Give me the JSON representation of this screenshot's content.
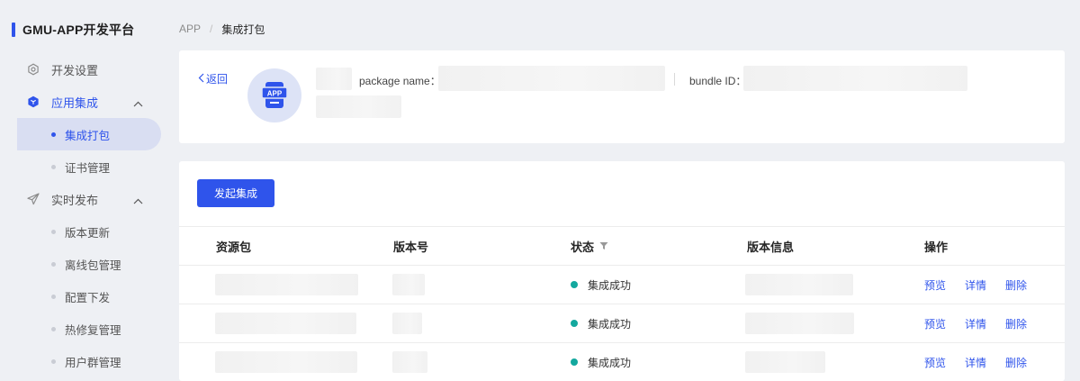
{
  "app": {
    "title": "GMU-APP开发平台"
  },
  "sidebar": {
    "groups": [
      {
        "label": "开发设置",
        "icon": "gear-icon"
      },
      {
        "label": "应用集成",
        "icon": "cube-icon",
        "expanded": true
      },
      {
        "label": "实时发布",
        "icon": "send-icon",
        "expanded": true
      }
    ],
    "sub_items": [
      {
        "label": "集成打包",
        "active": true
      },
      {
        "label": "证书管理"
      },
      {
        "label": "版本更新"
      },
      {
        "label": "离线包管理"
      },
      {
        "label": "配置下发"
      },
      {
        "label": "热修复管理"
      },
      {
        "label": "用户群管理"
      }
    ]
  },
  "breadcrumb": {
    "root": "APP",
    "separator": "/",
    "current": "集成打包"
  },
  "info": {
    "back": "返回",
    "logo_text": "APP",
    "package_name_label": "package name：",
    "bundle_id_label": "bundle ID："
  },
  "actions": {
    "start_integration": "发起集成"
  },
  "table": {
    "columns": [
      "资源包",
      "版本号",
      "状态",
      "版本信息",
      "操作"
    ],
    "rows": [
      {
        "status": "集成成功",
        "ops": [
          "预览",
          "详情",
          "删除"
        ]
      },
      {
        "status": "集成成功",
        "ops": [
          "预览",
          "详情",
          "删除"
        ]
      },
      {
        "status": "集成成功",
        "ops": [
          "预览",
          "详情",
          "删除"
        ]
      }
    ]
  },
  "colors": {
    "primary": "#2f54eb",
    "success": "#13a89e",
    "background": "#eef0f4",
    "active_bg": "#d9def2"
  }
}
